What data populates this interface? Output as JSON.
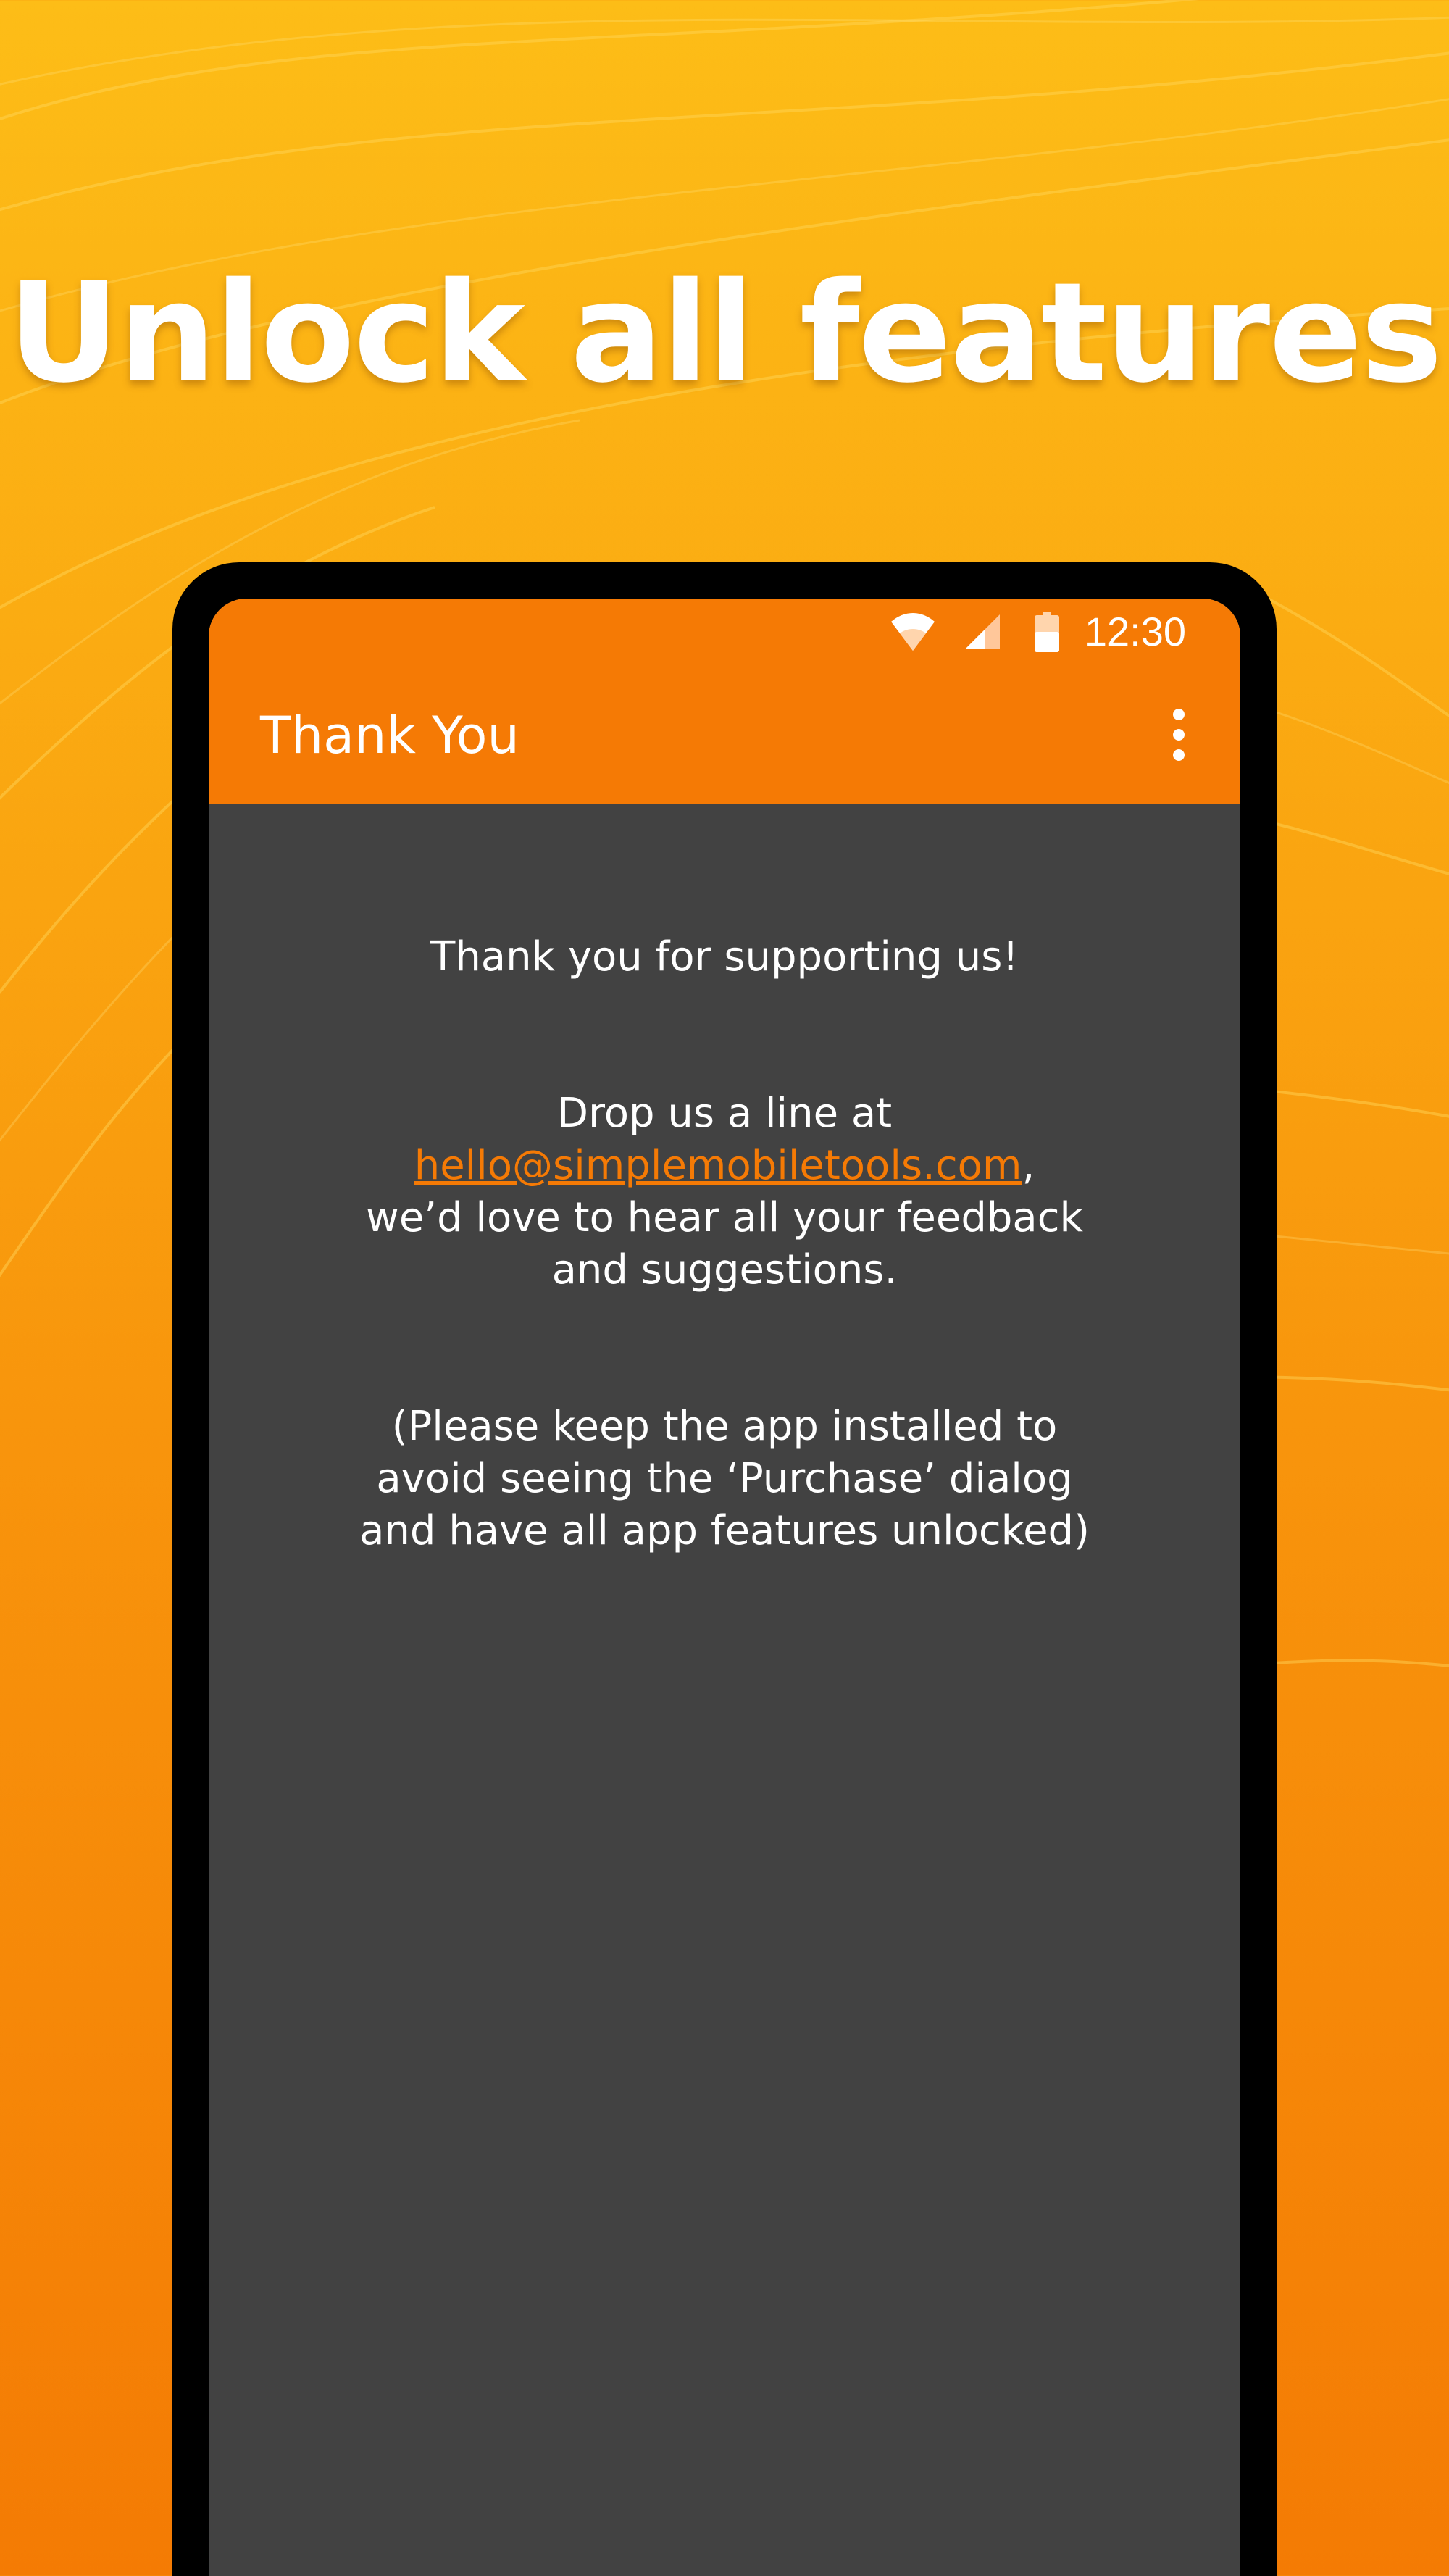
{
  "promo": {
    "headline": "Unlock all features"
  },
  "status_bar": {
    "time": "12:30",
    "icons": [
      "wifi-icon",
      "cellular-signal-icon",
      "battery-icon"
    ]
  },
  "toolbar": {
    "title": "Thank You",
    "menu_icon": "more-vert-icon"
  },
  "content": {
    "thanks_text": "Thank you for supporting us!",
    "contact_prefix": "Drop us a line at",
    "contact_email": "hello@simplemobiletools.com",
    "contact_comma": ",",
    "contact_suffix": "we’d love to hear all your feedback and suggestions.",
    "note_text": "(Please keep the app installed to avoid seeing the ‘Purchase’ dialog and have all app features unlocked)"
  },
  "colors": {
    "accent": "#f57a05",
    "background_top": "#fdbd17",
    "background_bottom": "#f47b04",
    "screen": "#424242"
  }
}
